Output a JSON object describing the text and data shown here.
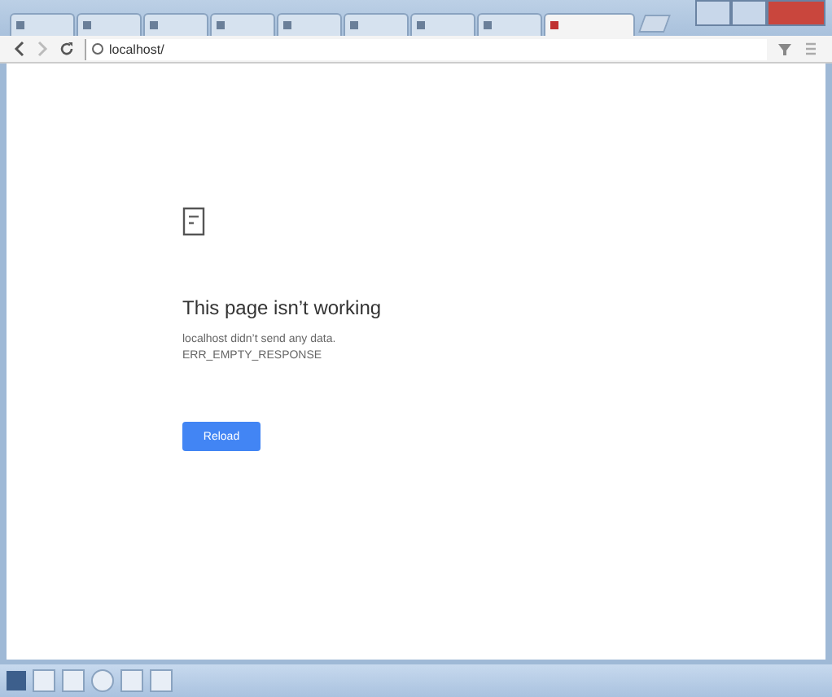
{
  "tabs": [
    {
      "selected": false
    },
    {
      "selected": false
    },
    {
      "selected": false
    },
    {
      "selected": false
    },
    {
      "selected": false
    },
    {
      "selected": false
    },
    {
      "selected": false
    },
    {
      "selected": false
    },
    {
      "selected": true
    }
  ],
  "address_bar": {
    "value": "localhost/"
  },
  "error": {
    "heading": "This page isn’t working",
    "description": "localhost didn’t send any data.",
    "code": "ERR_EMPTY_RESPONSE",
    "button": "Reload"
  }
}
